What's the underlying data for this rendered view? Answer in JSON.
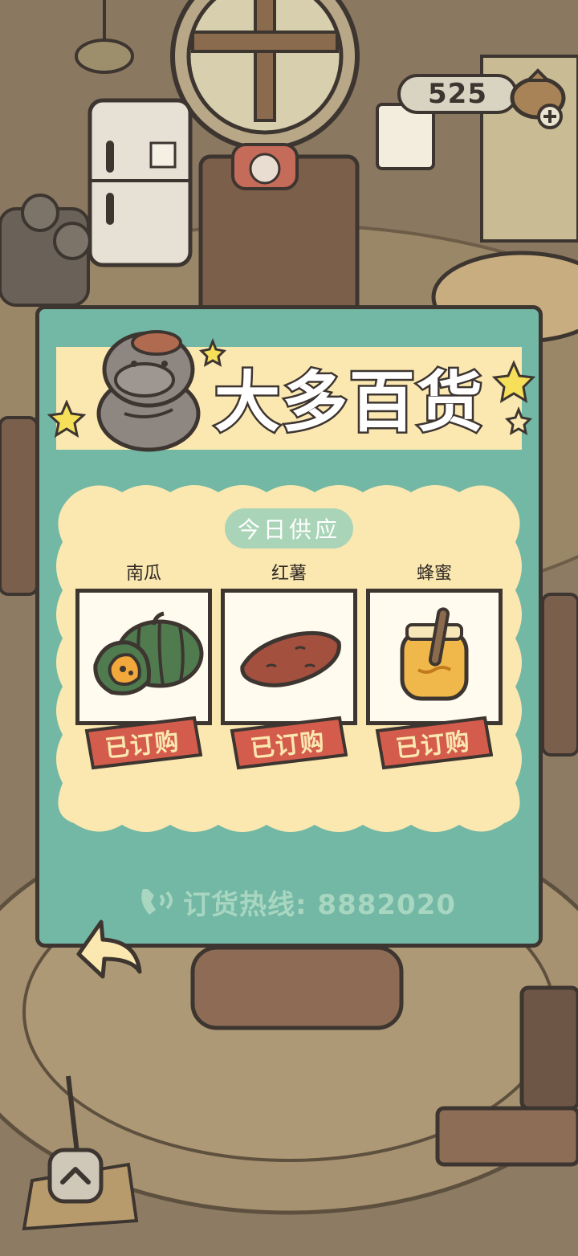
{
  "currency": {
    "amount": "525"
  },
  "shop": {
    "title": "大多百货",
    "supply_label": "今日供应",
    "items": [
      {
        "name": "南瓜",
        "status": "已订购",
        "icon": "pumpkin-icon"
      },
      {
        "name": "红薯",
        "status": "已订购",
        "icon": "sweet-potato-icon"
      },
      {
        "name": "蜂蜜",
        "status": "已订购",
        "icon": "honey-jar-icon"
      }
    ],
    "hotline": "订货热线: 8882020"
  },
  "colors": {
    "panel": "#72b8a5",
    "banner": "#fbe8b0",
    "card": "#fffcef",
    "tag": "#d45c4c",
    "outline": "#3d3530"
  }
}
